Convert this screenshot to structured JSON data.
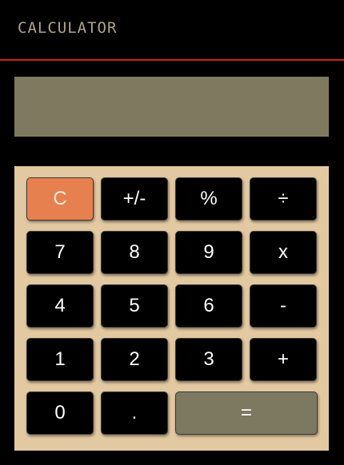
{
  "header": {
    "title": "CALCULATOR"
  },
  "display": {
    "value": ""
  },
  "keys": {
    "clear": "C",
    "sign": "+/-",
    "percent": "%",
    "divide": "÷",
    "seven": "7",
    "eight": "8",
    "nine": "9",
    "multiply": "x",
    "four": "4",
    "five": "5",
    "six": "6",
    "subtract": "-",
    "one": "1",
    "two": "2",
    "three": "3",
    "add": "+",
    "zero": "0",
    "decimal": ".",
    "equals": "="
  },
  "colors": {
    "background": "#000000",
    "header_rule": "#c8231c",
    "title": "#b0a48a",
    "display": "#7f7a5f",
    "keypad": "#e3c9a1",
    "clear_key": "#e6814f",
    "equals_key": "#7d7961",
    "key": "#000000"
  }
}
